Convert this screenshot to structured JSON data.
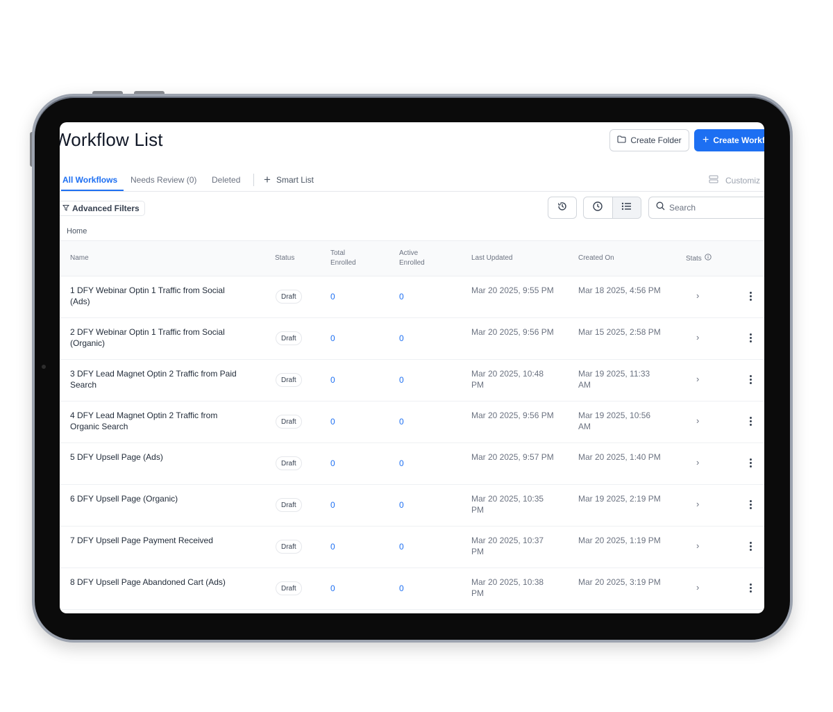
{
  "header": {
    "title": "Workflow List",
    "create_folder_label": "Create Folder",
    "create_workflow_label": "Create Workfl"
  },
  "tabs": [
    {
      "label": "All Workflows",
      "active": true
    },
    {
      "label": "Needs Review (0)",
      "active": false
    },
    {
      "label": "Deleted",
      "active": false
    }
  ],
  "smart_list_label": "Smart List",
  "customize_label": "Customiz",
  "filters": {
    "advanced_label": "Advanced Filters",
    "search_placeholder": "Search"
  },
  "breadcrumb": "Home",
  "columns": {
    "name": "Name",
    "status": "Status",
    "total_enrolled_1": "Total",
    "total_enrolled_2": "Enrolled",
    "active_enrolled_1": "Active",
    "active_enrolled_2": "Enrolled",
    "last_updated": "Last Updated",
    "created_on": "Created On",
    "stats": "Stats"
  },
  "rows": [
    {
      "name": "1 DFY Webinar Optin 1 Traffic from Social (Ads)",
      "status": "Draft",
      "total": "0",
      "active": "0",
      "updated": "Mar 20 2025, 9:55 PM",
      "created": "Mar 18 2025, 4:56 PM"
    },
    {
      "name": "2 DFY Webinar Optin 1 Traffic from Social (Organic)",
      "status": "Draft",
      "total": "0",
      "active": "0",
      "updated": "Mar 20 2025, 9:56 PM",
      "created": "Mar 15 2025, 2:58 PM"
    },
    {
      "name": "3 DFY Lead Magnet Optin 2 Traffic from Paid Search",
      "status": "Draft",
      "total": "0",
      "active": "0",
      "updated": "Mar 20 2025, 10:48 PM",
      "created": "Mar 19 2025, 11:33 AM"
    },
    {
      "name": "4 DFY Lead Magnet Optin 2 Traffic from Organic Search",
      "status": "Draft",
      "total": "0",
      "active": "0",
      "updated": "Mar 20 2025, 9:56 PM",
      "created": "Mar 19 2025, 10:56 AM"
    },
    {
      "name": "5 DFY Upsell Page (Ads)",
      "status": "Draft",
      "total": "0",
      "active": "0",
      "updated": "Mar 20 2025, 9:57 PM",
      "created": "Mar 20 2025, 1:40 PM"
    },
    {
      "name": "6 DFY Upsell Page (Organic)",
      "status": "Draft",
      "total": "0",
      "active": "0",
      "updated": "Mar 20 2025, 10:35 PM",
      "created": "Mar 19 2025, 2:19 PM"
    },
    {
      "name": "7 DFY Upsell Page Payment Received",
      "status": "Draft",
      "total": "0",
      "active": "0",
      "updated": "Mar 20 2025, 10:37 PM",
      "created": "Mar 20 2025, 1:19 PM"
    },
    {
      "name": "8 DFY Upsell Page Abandoned Cart (Ads)",
      "status": "Draft",
      "total": "0",
      "active": "0",
      "updated": "Mar 20 2025, 10:38 PM",
      "created": "Mar 20 2025, 3:19 PM"
    }
  ],
  "colors": {
    "accent": "#1d6ff2",
    "device_bezel": "#0b0b0b"
  },
  "icons": [
    "folder-icon",
    "plus-icon",
    "customize-icon",
    "filter-icon",
    "history-icon",
    "clock-icon",
    "list-icon",
    "search-icon",
    "info-icon",
    "chevron-right-icon",
    "kebab-menu-icon"
  ]
}
